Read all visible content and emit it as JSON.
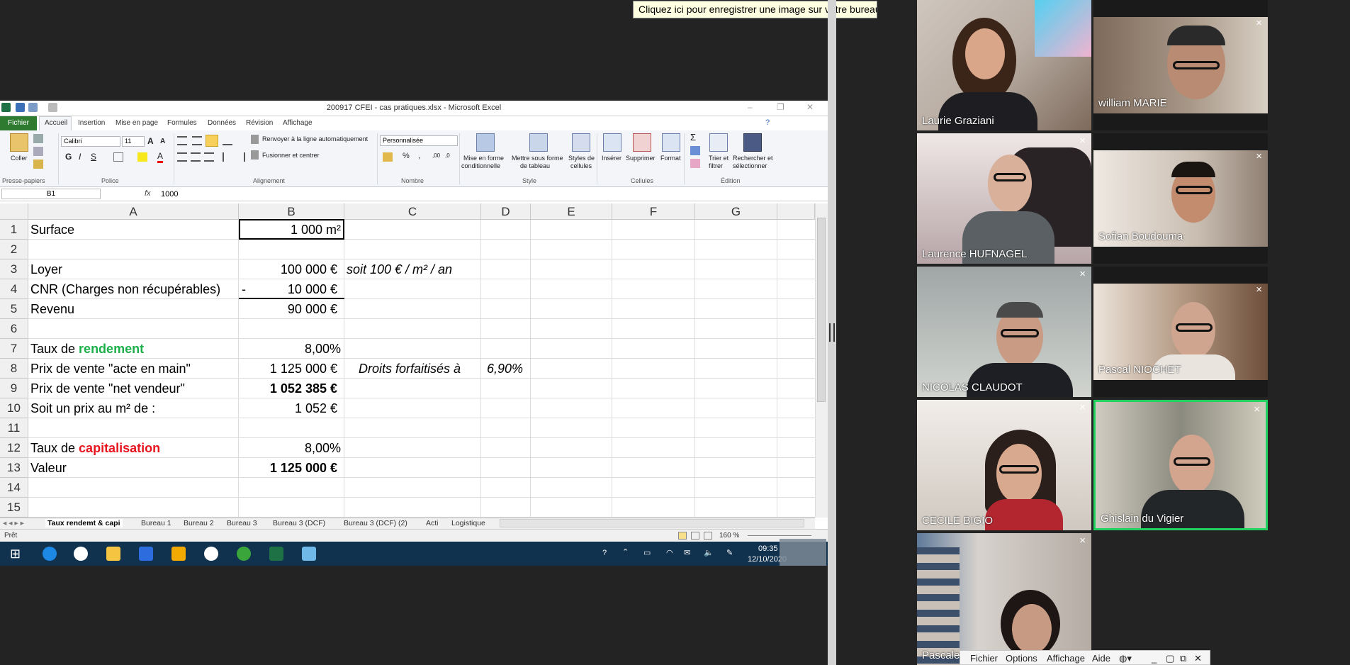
{
  "tooltip": "Cliquez ici pour enregistrer une image sur votre bureau.",
  "excel": {
    "title": "200917 CFEI - cas pratiques.xlsx - Microsoft Excel",
    "menu": {
      "fichier": "Fichier",
      "accueil": "Accueil",
      "insertion": "Insertion",
      "mise_en_page": "Mise en page",
      "formules": "Formules",
      "donnees": "Données",
      "revision": "Révision",
      "affichage": "Affichage"
    },
    "ribbon": {
      "coller": "Coller",
      "font_name": "Calibri",
      "font_size": "11",
      "wrap": "Renvoyer à la ligne automatiquement",
      "merge": "Fusionner et centrer",
      "number_format": "Personnalisée",
      "cond_format_1": "Mise en forme",
      "cond_format_2": "conditionnelle",
      "table_1": "Mettre sous forme",
      "table_2": "de tableau",
      "styles_1": "Styles de",
      "styles_2": "cellules",
      "inserer": "Insérer",
      "supprimer": "Supprimer",
      "format": "Format",
      "trier_1": "Trier et",
      "trier_2": "filtrer",
      "rechercher_1": "Rechercher et",
      "rechercher_2": "sélectionner",
      "groups": {
        "presse": "Presse-papiers",
        "police": "Police",
        "alignement": "Alignement",
        "nombre": "Nombre",
        "style": "Style",
        "cellules": "Cellules",
        "edition": "Édition"
      }
    },
    "namebox": "B1",
    "fx": "fx",
    "formula_value": "1000",
    "columns": [
      "A",
      "B",
      "C",
      "D",
      "E",
      "F",
      "G"
    ],
    "rows": [
      "1",
      "2",
      "3",
      "4",
      "5",
      "6",
      "7",
      "8",
      "9",
      "10",
      "11",
      "12",
      "13",
      "14",
      "15"
    ],
    "cells": {
      "a1": "Surface",
      "b1": "1 000 m²",
      "a3": "Loyer",
      "b3": "100 000 €",
      "c3": "soit 100 € / m² / an",
      "a4": "CNR (Charges non récupérables)",
      "b4_sign": "-",
      "b4": "10 000 €",
      "a5": "Revenu",
      "b5": "90 000 €",
      "a7_pre": "Taux de ",
      "a7_word": "rendement",
      "b7": "8,00%",
      "a8": "Prix de vente \"acte en main\"",
      "b8": "1 125 000 €",
      "c8": "Droits forfaitisés à",
      "d8": "6,90%",
      "a9": "Prix de vente \"net vendeur\"",
      "b9": "1 052 385 €",
      "a10": "Soit un prix au m² de :",
      "b10": "1 052 €",
      "a12_pre": "Taux de ",
      "a12_word": "capitalisation",
      "b12": "8,00%",
      "a13": "Valeur",
      "b13": "1 125 000 €"
    },
    "sheet_tabs": [
      "Taux rendemt & capi",
      "Bureau 1",
      "Bureau 2",
      "Bureau 3",
      "Bureau 3 (DCF)",
      "Bureau 3 (DCF) (2)",
      "Acti",
      "Logistique"
    ],
    "status": "Prêt",
    "zoom": "160 %",
    "time": "09:35",
    "date": "12/10/2020",
    "colors": {
      "green_text": "#1db04a",
      "red_text": "#e8141e",
      "fichier_tab": "#2f7a31",
      "taskbar": "#10324e"
    }
  },
  "participants": [
    {
      "name": "Laurie Graziani"
    },
    {
      "name": "william MARIE"
    },
    {
      "name": "Laurence HUFNAGEL"
    },
    {
      "name": "Sofian Boudouma"
    },
    {
      "name": "NICOLAS CLAUDOT"
    },
    {
      "name": "Pascal NIOCHET"
    },
    {
      "name": "CECILE BIGIO"
    },
    {
      "name": "Ghislain du Vigier",
      "active": true
    },
    {
      "name": "Pascale"
    }
  ],
  "bottom_menu": {
    "fichier": "Fichier",
    "options": "Options",
    "affichage": "Affichage",
    "aide": "Aide"
  },
  "icons": {
    "close": "×",
    "globe": "globe-icon"
  }
}
